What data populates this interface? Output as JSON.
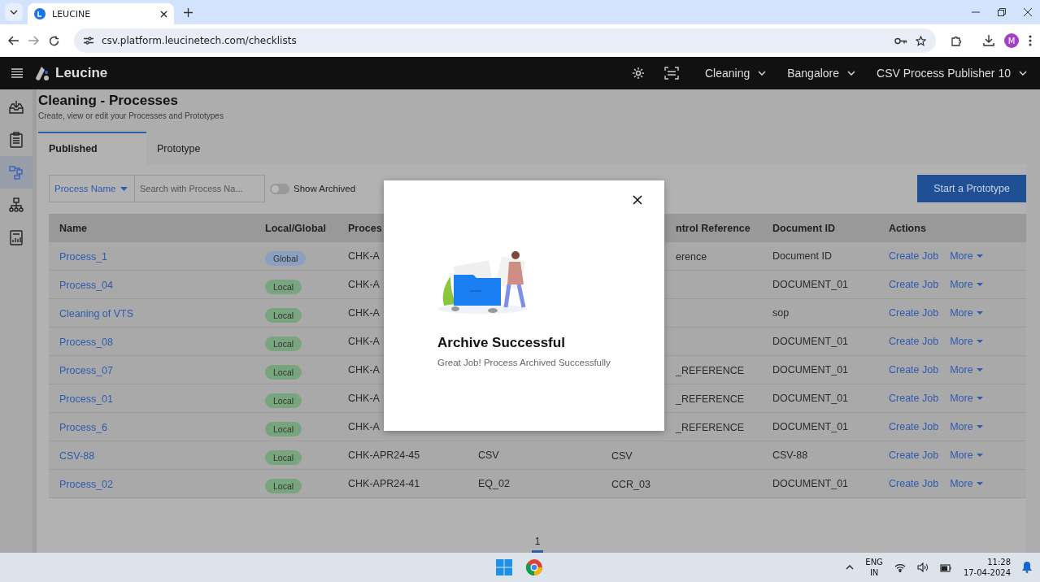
{
  "browser": {
    "tab": {
      "title": "LEUCINE"
    },
    "url": "csv.platform.leucinetech.com/checklists",
    "profile_initial": "M"
  },
  "header": {
    "brand": "Leucine",
    "menus": [
      {
        "label": "Cleaning"
      },
      {
        "label": "Bangalore"
      },
      {
        "label": "CSV Process Publisher 10"
      }
    ]
  },
  "sidebar": {
    "items": [
      {
        "kind": "inbox",
        "selected": false
      },
      {
        "kind": "clipboard",
        "selected": false
      },
      {
        "kind": "flow",
        "selected": true
      },
      {
        "kind": "hierarchy",
        "selected": false
      },
      {
        "kind": "report",
        "selected": false
      }
    ]
  },
  "page": {
    "title": "Cleaning - Processes",
    "subtitle": "Create, view or edit your Processes and Prototypes"
  },
  "tabs": [
    {
      "label": "Published",
      "selected": true
    },
    {
      "label": "Prototype",
      "selected": false
    }
  ],
  "filter": {
    "dropdown": "Process Name",
    "search_placeholder": "Search with Process Na...",
    "toggle": {
      "label": "Show Archived",
      "on": false
    },
    "button": "Start a Prototype"
  },
  "table": {
    "columns": [
      "Name",
      "Local/Global",
      "Proces",
      null,
      "ntrol Reference",
      "Document ID",
      "Actions"
    ],
    "rows": [
      {
        "name": "Process_1",
        "scope": {
          "label": "Global",
          "kind": "global"
        },
        "column_3": "CHK-A",
        "column_5": "erence",
        "document_id": "Document ID",
        "actions": [
          "Create Job",
          "More"
        ]
      },
      {
        "name": "Process_04",
        "scope": {
          "label": "Local",
          "kind": "local"
        },
        "column_3": "CHK-A",
        "document_id": "DOCUMENT_01",
        "actions": [
          "Create Job",
          "More"
        ]
      },
      {
        "name": "Cleaning of VTS",
        "scope": {
          "label": "Local",
          "kind": "local"
        },
        "column_3": "CHK-A",
        "document_id": "sop",
        "actions": [
          "Create Job",
          "More"
        ]
      },
      {
        "name": "Process_08",
        "scope": {
          "label": "Local",
          "kind": "local"
        },
        "column_3": "CHK-A",
        "document_id": "DOCUMENT_01",
        "actions": [
          "Create Job",
          "More"
        ]
      },
      {
        "name": "Process_07",
        "scope": {
          "label": "Local",
          "kind": "local"
        },
        "column_3": "CHK-A",
        "column_5": "_REFERENCE",
        "document_id": "DOCUMENT_01",
        "actions": [
          "Create Job",
          "More"
        ]
      },
      {
        "name": "Process_01",
        "scope": {
          "label": "Local",
          "kind": "local"
        },
        "column_3": "CHK-A",
        "column_5": "_REFERENCE",
        "document_id": "DOCUMENT_01",
        "actions": [
          "Create Job",
          "More"
        ]
      },
      {
        "name": "Process_6",
        "scope": {
          "label": "Local",
          "kind": "local"
        },
        "column_3": "CHK-A",
        "column_5": "_REFERENCE",
        "document_id": "DOCUMENT_01",
        "actions": [
          "Create Job",
          "More"
        ]
      },
      {
        "name": "CSV-88",
        "scope": {
          "label": "Local",
          "kind": "local"
        },
        "column_3": "CHK-APR24-45",
        "column_4": "CSV",
        "column_5": "CSV",
        "document_id": "CSV-88",
        "actions": [
          "Create Job",
          "More"
        ]
      },
      {
        "name": "Process_02",
        "scope": {
          "label": "Local",
          "kind": "local"
        },
        "column_3": "CHK-APR24-41",
        "column_4": "EQ_02",
        "column_5": "CCR_03",
        "document_id": "DOCUMENT_01",
        "actions": [
          "Create Job",
          "More"
        ]
      }
    ]
  },
  "pagination": [
    {
      "label": "1",
      "selected": true
    }
  ],
  "modal": {
    "title": "Archive Successful",
    "message": "Great Job! Process Archived Successfully"
  },
  "taskbar": {
    "language": "ENG",
    "region": "IN",
    "time": "11:28",
    "date": "17-04-2024"
  }
}
